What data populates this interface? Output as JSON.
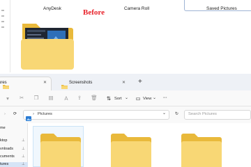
{
  "top": {
    "labels": [
      "AnyDesk",
      "Camera Roll",
      "Saved Pictures"
    ],
    "annotation": "Before"
  },
  "tabs": [
    {
      "label": "ures",
      "icon": "folder-icon"
    },
    {
      "label": "Screenshots",
      "icon": "folder-icon"
    }
  ],
  "toolbar": {
    "sort_label": "Sort",
    "view_label": "View",
    "more_label": "···"
  },
  "address": {
    "path": "Pictures"
  },
  "search": {
    "placeholder": "Search Pictures"
  },
  "nav": {
    "items": [
      {
        "label": "me"
      },
      {
        "label": "ktop"
      },
      {
        "label": "vnloads"
      },
      {
        "label": "cuments"
      },
      {
        "label": "tures"
      }
    ]
  },
  "colors": {
    "folder_yellow": "#f8d775",
    "folder_back": "#e9b93b",
    "annotation_red": "#e8222a",
    "selected_blue": "#d6e4f6"
  }
}
